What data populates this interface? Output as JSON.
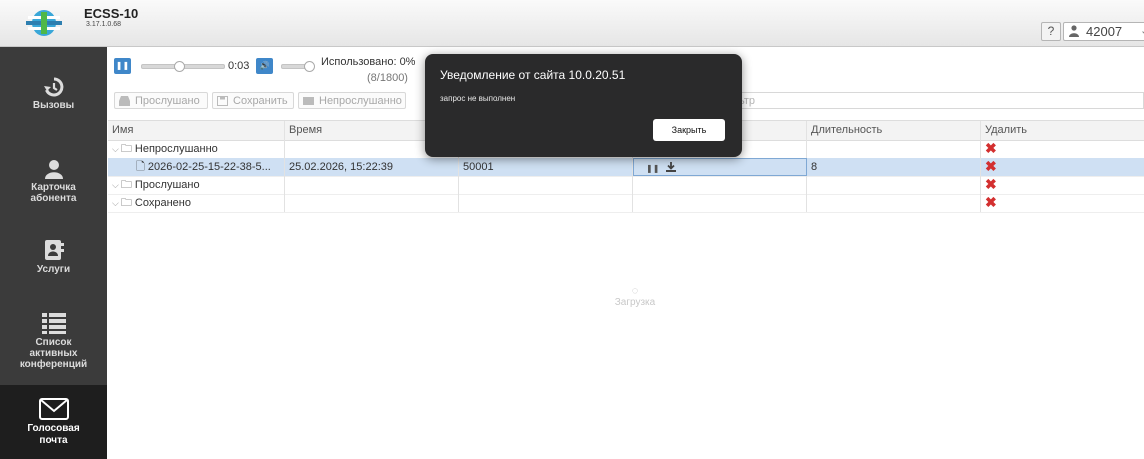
{
  "app": {
    "title": "ECSS-10",
    "version": "3.17.1.0.68"
  },
  "header": {
    "help_label": "?",
    "user": "42007",
    "user_icon": "user-icon",
    "dropdown_icon": "chevron-down-icon"
  },
  "sidebar": {
    "items": [
      {
        "label": "Вызовы",
        "icon": "call-history-icon",
        "active": false
      },
      {
        "label": "Карточка абонента",
        "icon": "person-icon",
        "active": false
      },
      {
        "label": "Услуги",
        "icon": "address-book-icon",
        "active": false
      },
      {
        "label": "Список активных конференций",
        "icon": "list-icon",
        "active": false
      },
      {
        "label": "Голосовая почта",
        "icon": "envelope-icon",
        "active": true
      }
    ]
  },
  "player": {
    "time": "0:03",
    "usage_label": "Использовано: 0%",
    "usage_count": "(8/1800)",
    "progress": 0.45
  },
  "toolbar": {
    "listened_label": "Прослушано",
    "save_label": "Сохранить",
    "unlistened_label": "Непрослушанно",
    "filter_placeholder_visible": "ьтр"
  },
  "grid": {
    "headers": {
      "name": "Имя",
      "time": "Время",
      "from": "",
      "actions": "",
      "duration": "Длительность",
      "delete": "Удалить"
    },
    "rows": [
      {
        "type": "folder",
        "name": "Непрослушанно",
        "time": "",
        "from": "",
        "duration": "",
        "selected": false
      },
      {
        "type": "file",
        "name": "2026-02-25-15-22-38-5...",
        "time": "25.02.2026, 15:22:39",
        "from": "50001",
        "duration": "8",
        "selected": true
      },
      {
        "type": "folder",
        "name": "Прослушано",
        "time": "",
        "from": "",
        "duration": "",
        "selected": false
      },
      {
        "type": "folder",
        "name": "Сохранено",
        "time": "",
        "from": "",
        "duration": "",
        "selected": false
      }
    ],
    "delete_symbol": "✖"
  },
  "loading": {
    "label": "Загрузка"
  },
  "dialog": {
    "title": "Уведомление от сайта 10.0.20.51",
    "message": "запрос не выполнен",
    "close_label": "Закрыть"
  },
  "colors": {
    "accent": "#3f87c9",
    "sidebar": "#3b3b3b",
    "delete": "#d32f2f",
    "selected_row": "#cfe0f3"
  }
}
